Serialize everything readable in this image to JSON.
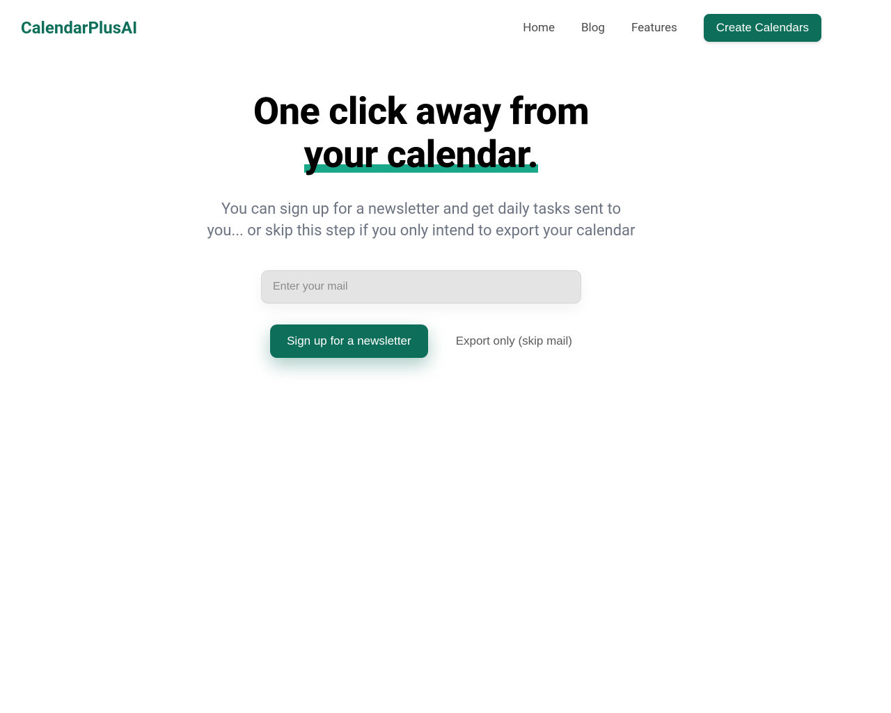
{
  "header": {
    "logo": "CalendarPlusAI",
    "nav": {
      "home": "Home",
      "blog": "Blog",
      "features": "Features",
      "create_calendars": "Create Calendars"
    }
  },
  "main": {
    "title_line1": "One click away from",
    "title_line2": "your calendar.",
    "subtitle": "You can sign up for a newsletter and get daily tasks sent to you... or skip this step if you only intend to export your calendar",
    "email_placeholder": "Enter your mail",
    "signup_button": "Sign up for a newsletter",
    "skip_link": "Export only (skip mail)"
  }
}
